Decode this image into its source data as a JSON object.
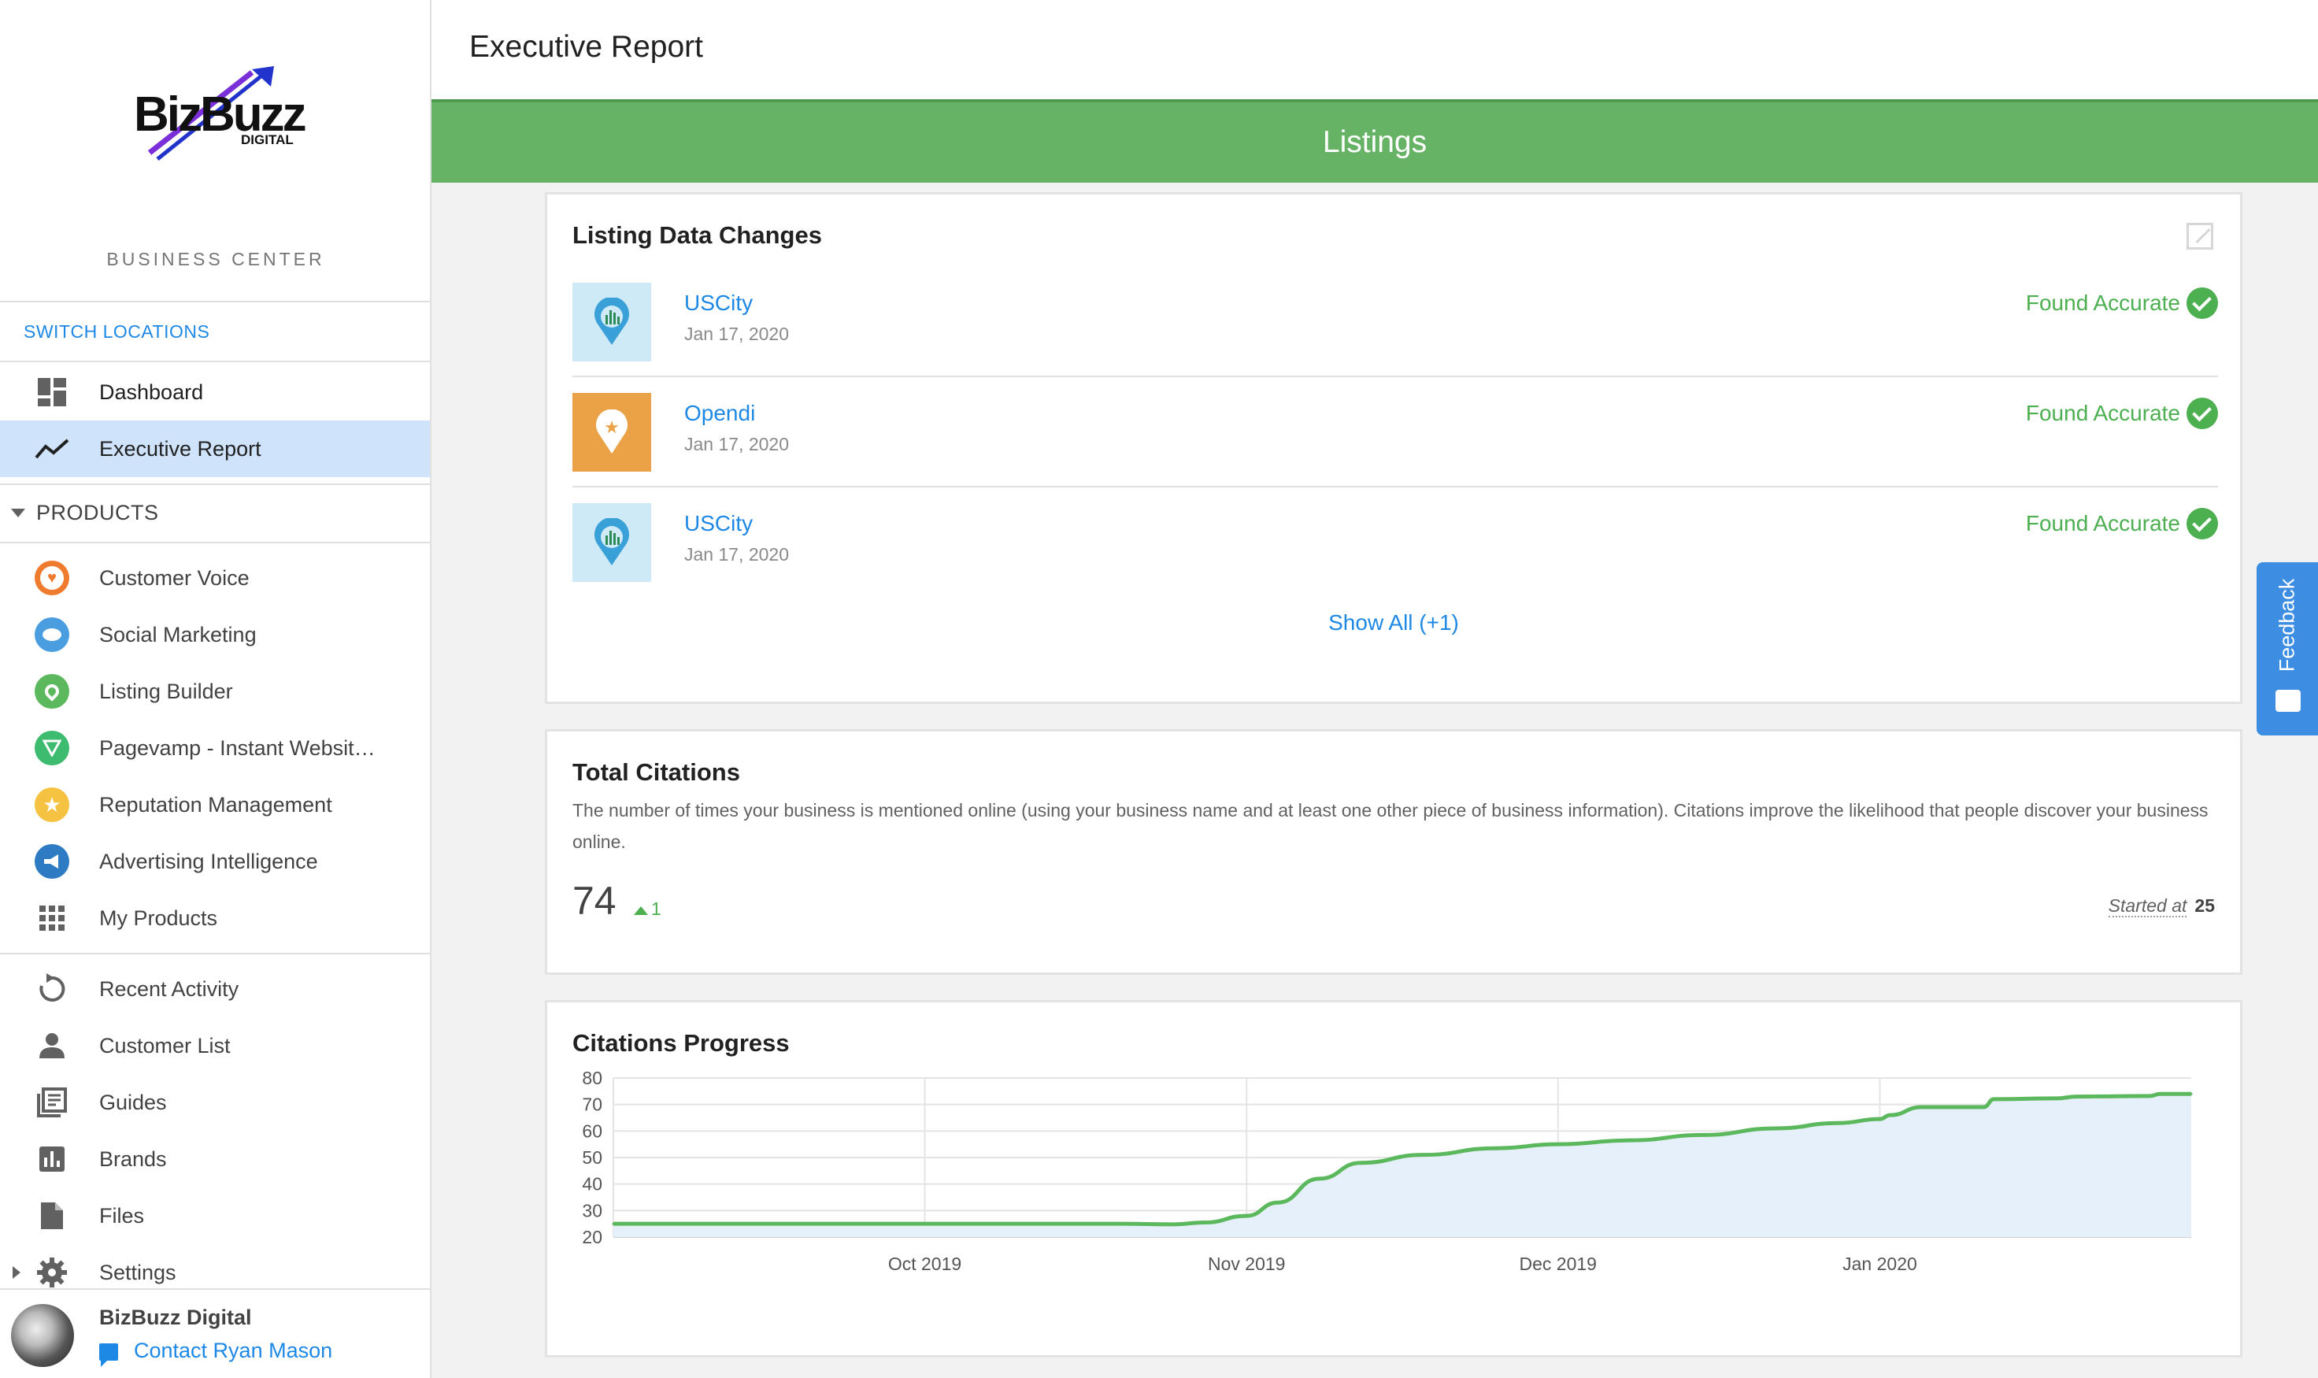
{
  "app": {
    "logo_text": "BizBuzz",
    "logo_sub": "DIGITAL",
    "section_label": "BUSINESS CENTER",
    "switch_locations": "SWITCH LOCATIONS"
  },
  "nav": {
    "top_items": [
      {
        "label": "Dashboard",
        "icon": "dashboard-icon"
      },
      {
        "label": "Executive Report",
        "icon": "trending-icon",
        "active": true
      }
    ],
    "products_label": "PRODUCTS",
    "products": [
      {
        "label": "Customer Voice",
        "icon": "customer-voice-icon",
        "color": "#ef7c2e"
      },
      {
        "label": "Social Marketing",
        "icon": "social-marketing-icon",
        "color": "#4a9ee0"
      },
      {
        "label": "Listing Builder",
        "icon": "listing-builder-icon",
        "color": "#5cb85c"
      },
      {
        "label": "Pagevamp - Instant Websit…",
        "icon": "pagevamp-icon",
        "color": "#3dbb6e"
      },
      {
        "label": "Reputation Management",
        "icon": "reputation-icon",
        "color": "#f5c242"
      },
      {
        "label": "Advertising Intelligence",
        "icon": "advertising-icon",
        "color": "#2e7bc4"
      },
      {
        "label": "My Products",
        "icon": "grid-icon",
        "color": "#616161"
      }
    ],
    "other_items": [
      {
        "label": "Recent Activity",
        "icon": "refresh-icon"
      },
      {
        "label": "Customer List",
        "icon": "person-icon"
      },
      {
        "label": "Guides",
        "icon": "guides-icon"
      },
      {
        "label": "Brands",
        "icon": "bar-chart-icon"
      },
      {
        "label": "Files",
        "icon": "file-icon"
      },
      {
        "label": "Settings",
        "icon": "gear-icon"
      }
    ]
  },
  "account": {
    "name": "BizBuzz Digital",
    "contact": "Contact Ryan Mason"
  },
  "header": {
    "title": "Executive Report"
  },
  "banner": {
    "title": "Listings"
  },
  "listing_changes": {
    "title": "Listing Data Changes",
    "rows": [
      {
        "source": "USCity",
        "date": "Jan 17, 2020",
        "status": "Found Accurate",
        "thumb_color": "#cfeaf7"
      },
      {
        "source": "Opendi",
        "date": "Jan 17, 2020",
        "status": "Found Accurate",
        "thumb_color": "#eba246"
      },
      {
        "source": "USCity",
        "date": "Jan 17, 2020",
        "status": "Found Accurate",
        "thumb_color": "#cfeaf7"
      }
    ],
    "show_all": "Show All (+1)"
  },
  "citations": {
    "title": "Total Citations",
    "description": "The number of times your business is mentioned online (using your business name and at least one other piece of business information). Citations improve the likelihood that people discover your business online.",
    "value": "74",
    "delta": "1",
    "started_label": "Started at",
    "started_value": "25"
  },
  "progress": {
    "title": "Citations Progress"
  },
  "feedback": {
    "label": "Feedback"
  },
  "chart_data": {
    "type": "area",
    "title": "Citations Progress",
    "xlabel": "",
    "ylabel": "",
    "ylim": [
      20,
      80
    ],
    "yticks": [
      20,
      30,
      40,
      50,
      60,
      70,
      80
    ],
    "xticks": [
      "Oct 2019",
      "Nov 2019",
      "Dec 2019",
      "Jan 2020"
    ],
    "grid": true,
    "series": [
      {
        "values": [
          {
            "x": "2019-09-01",
            "y": 25
          },
          {
            "x": "2019-09-15",
            "y": 25
          },
          {
            "x": "2019-10-01",
            "y": 25
          },
          {
            "x": "2019-10-15",
            "y": 25
          },
          {
            "x": "2019-10-20",
            "y": 25
          },
          {
            "x": "2019-10-25",
            "y": 24.8
          },
          {
            "x": "2019-10-28",
            "y": 25.5
          },
          {
            "x": "2019-11-01",
            "y": 28
          },
          {
            "x": "2019-11-04",
            "y": 33
          },
          {
            "x": "2019-11-08",
            "y": 42
          },
          {
            "x": "2019-11-12",
            "y": 48
          },
          {
            "x": "2019-11-18",
            "y": 51
          },
          {
            "x": "2019-11-25",
            "y": 53.5
          },
          {
            "x": "2019-12-01",
            "y": 55
          },
          {
            "x": "2019-12-08",
            "y": 56.5
          },
          {
            "x": "2019-12-15",
            "y": 58.5
          },
          {
            "x": "2019-12-22",
            "y": 61
          },
          {
            "x": "2019-12-28",
            "y": 63
          },
          {
            "x": "2020-01-01",
            "y": 64.5
          },
          {
            "x": "2020-01-02",
            "y": 66
          },
          {
            "x": "2020-01-05",
            "y": 69
          },
          {
            "x": "2020-01-11",
            "y": 69
          },
          {
            "x": "2020-01-12",
            "y": 72
          },
          {
            "x": "2020-01-18",
            "y": 72.3
          },
          {
            "x": "2020-01-20",
            "y": 73
          },
          {
            "x": "2020-01-27",
            "y": 73.2
          },
          {
            "x": "2020-01-28",
            "y": 74
          },
          {
            "x": "2020-01-31",
            "y": 74
          }
        ],
        "color": "#5cb85c",
        "fill": "#e6f0fb"
      }
    ]
  }
}
